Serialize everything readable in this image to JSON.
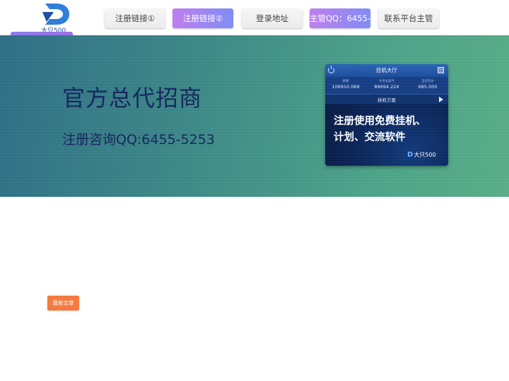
{
  "logo": {
    "text": "大只500"
  },
  "nav": [
    {
      "label": "注册链接①",
      "style": "plain"
    },
    {
      "label": "注册链接②",
      "style": "gradient"
    },
    {
      "label": "登录地址",
      "style": "plain"
    },
    {
      "label": "主管QQ：6455-",
      "style": "gradient"
    },
    {
      "label": "联系平台主管",
      "style": "plain"
    }
  ],
  "hero": {
    "title": "官方总代招商",
    "subtitle": "注册咨询QQ:6455-5253"
  },
  "panel": {
    "title": "挂机大厅",
    "stats": [
      {
        "label": "余额",
        "value": "106910.069"
      },
      {
        "label": "今日总盈亏",
        "value": "89694.224"
      },
      {
        "label": "当前流水",
        "value": "685.000"
      }
    ],
    "plan_label": "挂机方案",
    "promo_line1": "注册使用免费挂机、",
    "promo_line2": "计划、交流软件",
    "logo_text": "大只500",
    "logo_mark": "D"
  },
  "badge": {
    "label": "最新文章"
  },
  "colors": {
    "accent_gradient_start": "#c07ef0",
    "accent_gradient_end": "#7f8df5",
    "hero_start": "#2f6f88",
    "hero_end": "#5aae88",
    "title_text": "#15265e",
    "badge": "#f47a3f"
  }
}
